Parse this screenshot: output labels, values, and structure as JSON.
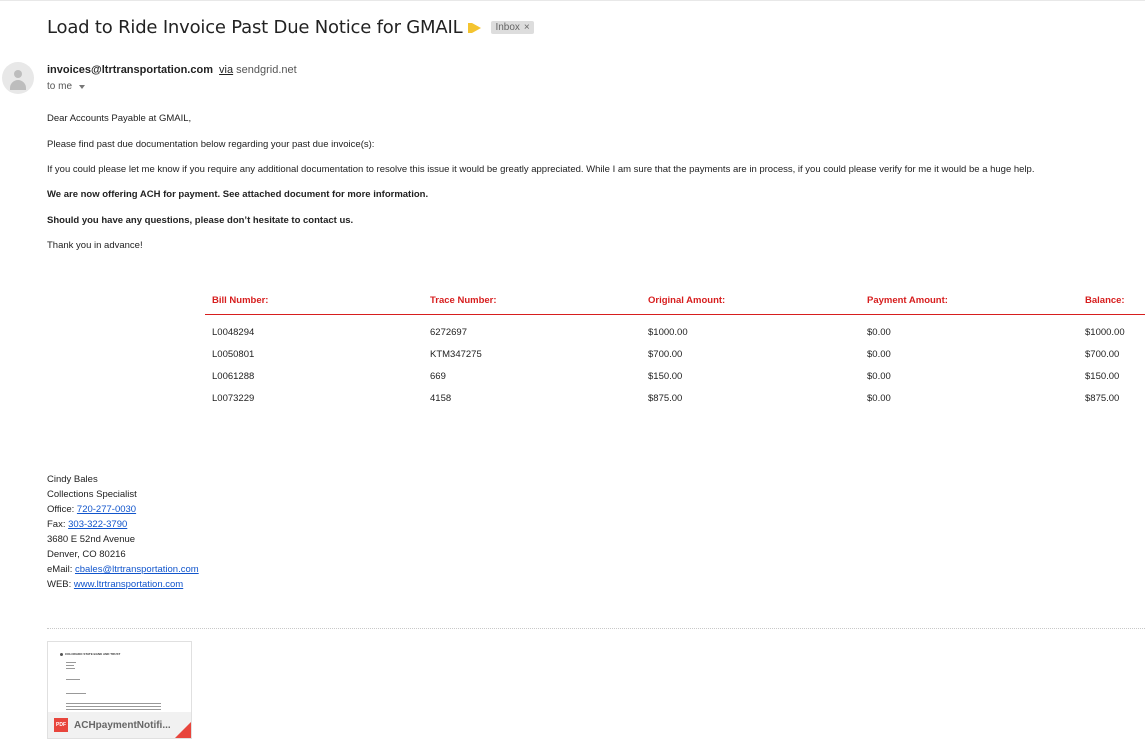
{
  "email": {
    "subject": "Load to Ride Invoice Past Due Notice for GMAIL",
    "label": "Inbox",
    "label_remove": "×",
    "sender_email": "invoices@ltrtransportation.com",
    "via_text": "via",
    "via_domain": "sendgrid.net",
    "recipient": "to me",
    "colors": {
      "accent_red": "#d71e1e",
      "importance_marker": "#f4c430",
      "link": "#1155cc"
    }
  },
  "body": {
    "greeting": "Dear Accounts Payable at GMAIL,",
    "p1": "Please find past due documentation below regarding your past due invoice(s):",
    "p2": "If you could please let me know if you require any additional documentation to resolve this issue it would be greatly appreciated. While I am sure that the payments are in process, if you could please verify for me it would be a huge help.",
    "p3": "We are now offering ACH for payment. See attached document for more information.",
    "p4": "Should you have any questions, please don’t hesitate to contact us.",
    "p5": "Thank you in advance!"
  },
  "table": {
    "headers": [
      "Bill Number:",
      "Trace Number:",
      "Original Amount:",
      "Payment Amount:",
      "Balance:"
    ],
    "rows": [
      [
        "L0048294",
        "6272697",
        "$1000.00",
        "$0.00",
        "$1000.00"
      ],
      [
        "L0050801",
        "KTM347275",
        "$700.00",
        "$0.00",
        "$700.00"
      ],
      [
        "L0061288",
        "669",
        "$150.00",
        "$0.00",
        "$150.00"
      ],
      [
        "L0073229",
        "4158",
        "$875.00",
        "$0.00",
        "$875.00"
      ]
    ]
  },
  "signature": {
    "name": "Cindy Bales",
    "title": "Collections Specialist",
    "office_label": "Office:",
    "office": "720-277-0030",
    "fax_label": "Fax:",
    "fax": "303-322-3790",
    "address1": "3680 E 52nd Avenue",
    "address2": "Denver, CO 80216",
    "email_label": "eMail:",
    "email": "cbales@ltrtransportation.com",
    "web_label": "WEB:",
    "web": "www.ltrtransportation.com"
  },
  "attachment": {
    "filename": "ACHpaymentNotifi...",
    "type_icon": "PDF",
    "preview_header": "COLORADO STATE BANK AND TRUST"
  }
}
